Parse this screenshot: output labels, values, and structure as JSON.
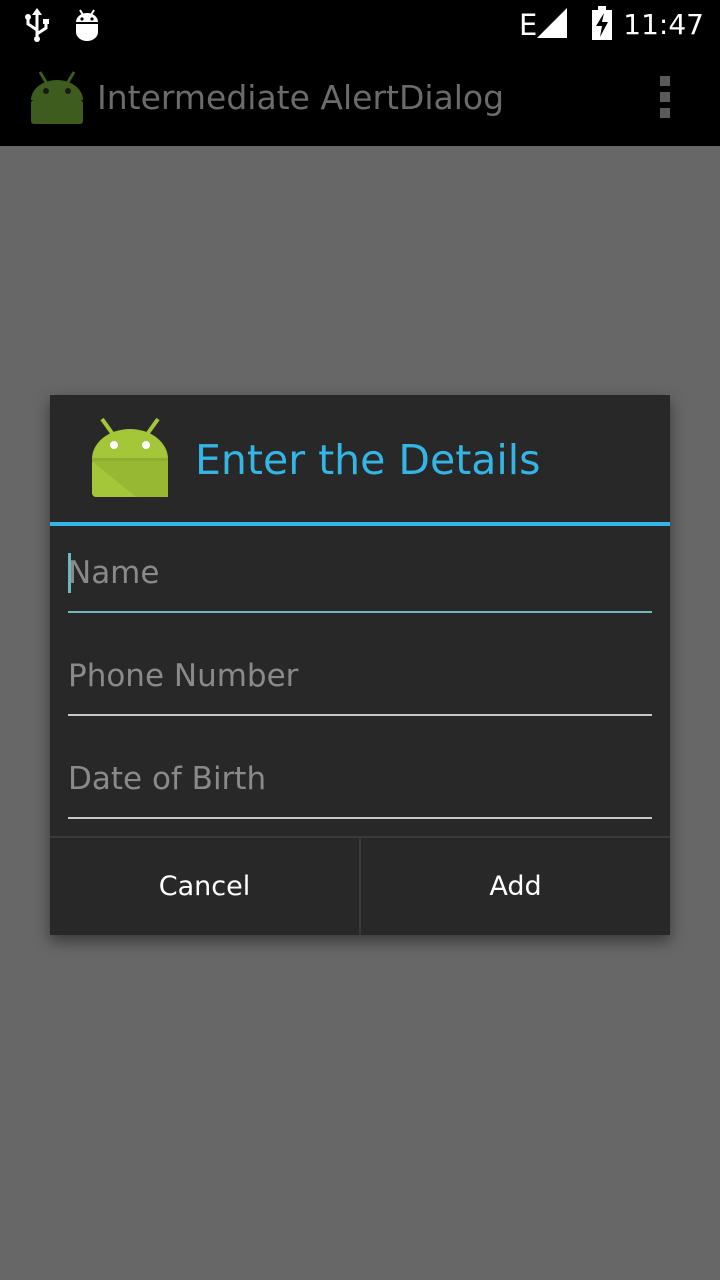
{
  "status_bar": {
    "usb_icon": "usb-icon",
    "debug_icon": "android-debug-icon",
    "network_type": "E",
    "signal_icon": "signal-icon",
    "battery_icon": "battery-charging-icon",
    "time": "11:47"
  },
  "action_bar": {
    "app_icon": "android-app-icon",
    "title": "Intermediate AlertDialog",
    "overflow_icon": "overflow-menu-icon"
  },
  "dialog": {
    "icon": "android-app-icon",
    "title": "Enter the Details",
    "accent_color": "#33b5e5",
    "fields": [
      {
        "placeholder": "Name",
        "value": "",
        "focused": true
      },
      {
        "placeholder": "Phone Number",
        "value": ""
      },
      {
        "placeholder": "Date of Birth",
        "value": ""
      }
    ],
    "buttons": {
      "negative": "Cancel",
      "positive": "Add"
    }
  }
}
